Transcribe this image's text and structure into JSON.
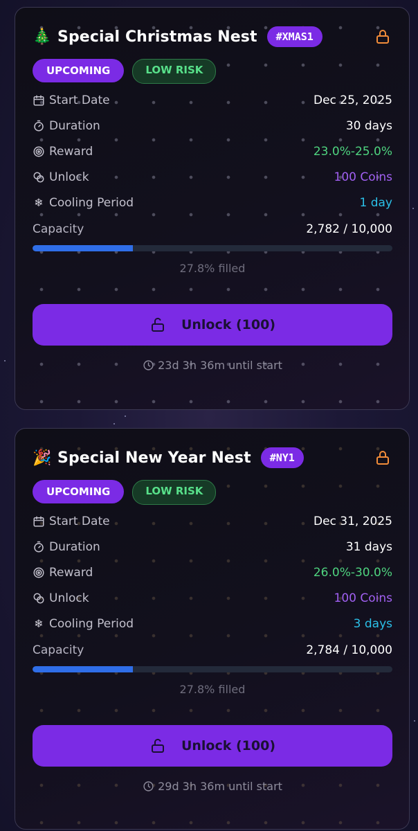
{
  "cards": [
    {
      "emoji": "🎄",
      "title": "Special Christmas Nest",
      "tag": "#XMAS1",
      "status_badge": "UPCOMING",
      "risk_badge": "LOW RISK",
      "rows": {
        "start_date": {
          "label": "Start Date",
          "value": "Dec 25, 2025"
        },
        "duration": {
          "label": "Duration",
          "value": "30 days"
        },
        "reward": {
          "label": "Reward",
          "value": "23.0%-25.0%"
        },
        "unlock": {
          "label": "Unlock",
          "value": "100 Coins"
        },
        "cooling": {
          "label": "Cooling Period",
          "value": "1 day"
        }
      },
      "capacity": {
        "label": "Capacity",
        "value": "2,782 / 10,000",
        "fill_fraction": 0.278,
        "filled_text": "27.8% filled"
      },
      "button_label": "Unlock (100)",
      "countdown": "23d 3h 36m until start"
    },
    {
      "emoji": "🎉",
      "title": "Special New Year Nest",
      "tag": "#NY1",
      "status_badge": "UPCOMING",
      "risk_badge": "LOW RISK",
      "rows": {
        "start_date": {
          "label": "Start Date",
          "value": "Dec 31, 2025"
        },
        "duration": {
          "label": "Duration",
          "value": "31 days"
        },
        "reward": {
          "label": "Reward",
          "value": "26.0%-30.0%"
        },
        "unlock": {
          "label": "Unlock",
          "value": "100 Coins"
        },
        "cooling": {
          "label": "Cooling Period",
          "value": "3 days"
        }
      },
      "capacity": {
        "label": "Capacity",
        "value": "2,784 / 10,000",
        "fill_fraction": 0.278,
        "filled_text": "27.8% filled"
      },
      "button_label": "Unlock (100)",
      "countdown": "29d 3h 36m until start"
    }
  ],
  "colors": {
    "accent_purple": "#7b2be5",
    "lock_orange": "#f28c3a",
    "reward_green": "#4fd47f",
    "unlock_purple": "#a160f2",
    "cooling_cyan": "#2bc0e8",
    "progress_blue": "#2f6ee8"
  },
  "icons": [
    "tree-icon",
    "party-popper-icon",
    "lock-icon",
    "calendar-icon",
    "timer-icon",
    "target-icon",
    "coins-icon",
    "snowflake-icon",
    "unlock-icon",
    "clock-icon"
  ]
}
